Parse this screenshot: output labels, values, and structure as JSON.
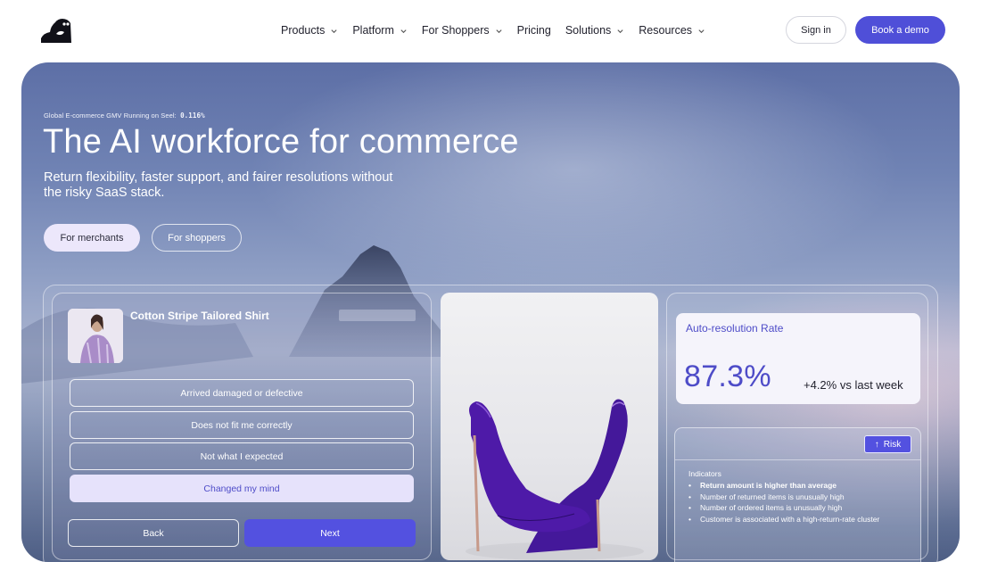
{
  "nav": {
    "menu": [
      {
        "label": "Products",
        "has_dropdown": true
      },
      {
        "label": "Platform",
        "has_dropdown": true
      },
      {
        "label": "For Shoppers",
        "has_dropdown": true
      },
      {
        "label": "Pricing",
        "has_dropdown": false
      },
      {
        "label": "Solutions",
        "has_dropdown": true
      },
      {
        "label": "Resources",
        "has_dropdown": true
      }
    ],
    "sign_in": "Sign in",
    "book_demo": "Book a demo"
  },
  "hero": {
    "gmv_label": "Global E-commerce GMV Running on Seel:",
    "gmv_value": "0.116%",
    "headline": "The AI workforce for commerce",
    "subline": "Return flexibility, faster support, and fairer resolutions without the risky SaaS stack.",
    "for_merchants": "For merchants",
    "for_shoppers": "For shoppers"
  },
  "return_card": {
    "product_name": "Cotton Stripe Tailored Shirt",
    "reasons": [
      {
        "label": "Arrived damaged or defective",
        "selected": false
      },
      {
        "label": "Does not fit me correctly",
        "selected": false
      },
      {
        "label": "Not what I expected",
        "selected": false
      },
      {
        "label": "Changed my mind",
        "selected": true
      }
    ],
    "back": "Back",
    "next": "Next"
  },
  "rate_card": {
    "label": "Auto-resolution Rate",
    "value": "87.3%",
    "delta": "+4.2% vs last week"
  },
  "risk_card": {
    "badge": "Risk",
    "indicators_title": "Indicators",
    "indicators": [
      "Return amount is higher than average",
      "Number of returned items is unusually high",
      "Number of ordered items is unusually high",
      "Customer is associated with a high-return-rate cluster"
    ]
  },
  "colors": {
    "accent": "#4f4fd8",
    "selected_bg": "#e6e2fb",
    "shoe": "#4b1f9c"
  }
}
